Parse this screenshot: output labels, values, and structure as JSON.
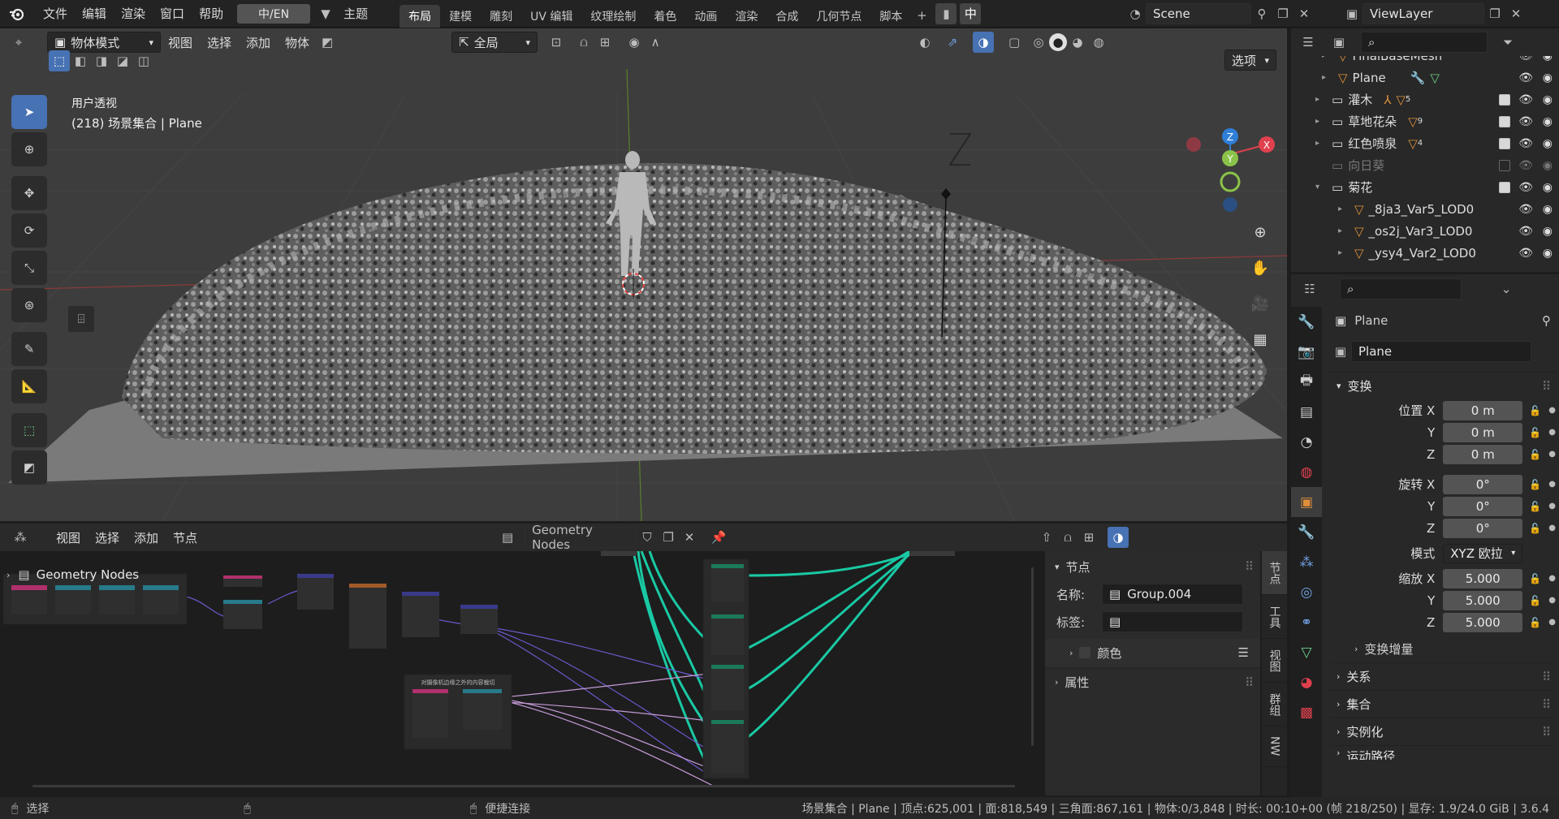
{
  "topbar": {
    "menus": [
      "文件",
      "编辑",
      "渲染",
      "窗口",
      "帮助"
    ],
    "lang_toggle": "中/EN",
    "theme_menu": "主题",
    "workspaces": [
      "布局",
      "建模",
      "雕刻",
      "UV 编辑",
      "纹理绘制",
      "着色",
      "动画",
      "渲染",
      "合成",
      "几何节点",
      "脚本"
    ],
    "active_workspace": "布局",
    "ime_indicator": "中",
    "scene_name": "Scene",
    "view_layer": "ViewLayer"
  },
  "viewport": {
    "mode": "物体模式",
    "menus": [
      "视图",
      "选择",
      "添加",
      "物体"
    ],
    "transform_orientation": "全局",
    "options_label": "选项",
    "overlay_title": "用户透视",
    "overlay_subtitle": "(218) 场景集合 | Plane",
    "gizmo": {
      "x": "X",
      "y": "Y",
      "z": "Z"
    }
  },
  "outliner": {
    "items": [
      {
        "name": "FinalBaseMesh",
        "indent": 2,
        "type": "mesh",
        "has_checkbox": false,
        "excluded": false
      },
      {
        "name": "Plane",
        "indent": 2,
        "type": "mesh",
        "has_checkbox": false,
        "excluded": false
      },
      {
        "name": "灌木",
        "indent": 1,
        "type": "collection",
        "badge": "5",
        "has_checkbox": true,
        "excluded": false
      },
      {
        "name": "草地花朵",
        "indent": 1,
        "type": "collection",
        "badge": "9",
        "has_checkbox": true,
        "excluded": false
      },
      {
        "name": "红色喷泉",
        "indent": 1,
        "type": "collection",
        "badge": "4",
        "has_checkbox": true,
        "excluded": false
      },
      {
        "name": "向日葵",
        "indent": 1,
        "type": "collection",
        "badge": "",
        "has_checkbox": true,
        "excluded": true
      },
      {
        "name": "菊花",
        "indent": 1,
        "type": "collection",
        "badge": "",
        "has_checkbox": true,
        "excluded": false,
        "expanded": true
      },
      {
        "name": "_8ja3_Var5_LOD0",
        "indent": 2,
        "type": "mesh",
        "has_checkbox": false,
        "excluded": false
      },
      {
        "name": "_os2j_Var3_LOD0",
        "indent": 2,
        "type": "mesh",
        "has_checkbox": false,
        "excluded": false
      },
      {
        "name": "_ysy4_Var2_LOD0",
        "indent": 2,
        "type": "mesh",
        "has_checkbox": false,
        "excluded": false
      }
    ]
  },
  "properties": {
    "object_name": "Plane",
    "data_name": "Plane",
    "transform_section": "变换",
    "location_label": "位置 X",
    "rotation_label": "旋转 X",
    "scale_label": "缩放 X",
    "axis_y": "Y",
    "axis_z": "Z",
    "location": [
      "0 m",
      "0 m",
      "0 m"
    ],
    "rotation": [
      "0°",
      "0°",
      "0°"
    ],
    "mode_label": "模式",
    "mode_value": "XYZ 欧拉",
    "scale": [
      "5.000",
      "5.000",
      "5.000"
    ],
    "delta_transform": "变换增量",
    "sections": [
      "关系",
      "集合",
      "实例化",
      "运动路径"
    ]
  },
  "node_editor": {
    "menus": [
      "视图",
      "选择",
      "添加",
      "节点"
    ],
    "tree_name": "Geometry Nodes",
    "breadcrumb": "Geometry Nodes",
    "frame_label": "对摄像机边缘之外的内容裁切",
    "panel": {
      "section_title": "节点",
      "name_label": "名称:",
      "name_value": "Group.004",
      "label_label": "标签:",
      "label_value": "",
      "color_label": "颜色",
      "properties_label": "属性"
    },
    "side_tabs": [
      "节点",
      "工具",
      "视图",
      "群组",
      "NW"
    ]
  },
  "statusbar": {
    "select_label": "选择",
    "connect_label": "便捷连接",
    "stats": "场景集合 | Plane | 顶点:625,001 | 面:818,549 | 三角面:867,161 | 物体:0/3,848 | 时长: 00:10+00 (帧 218/250) | 显存: 1.9/24.0 GiB | 3.6.4"
  },
  "colors": {
    "accent": "#4772b3",
    "x_axis": "#e0404e",
    "y_axis": "#8bc34a",
    "z_axis": "#2f7fd8",
    "link_geometry": "#19c9a4",
    "link_vector": "#6a5acd",
    "mesh_orange": "#e0903a"
  }
}
